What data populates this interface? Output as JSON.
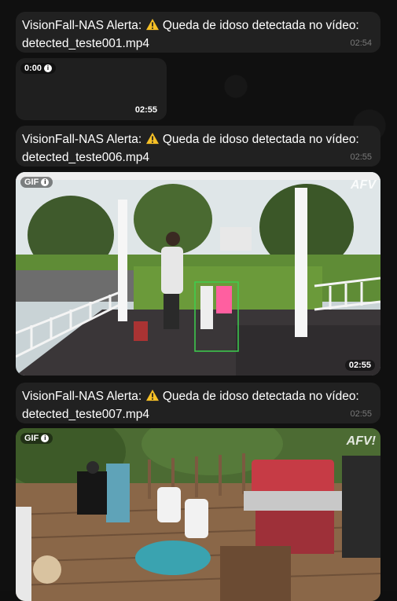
{
  "messages": [
    {
      "sender": "VisionFall-NAS Alerta:",
      "text": "Queda de idoso detectada no vídeo:",
      "file": "detected_teste001.mp4",
      "time": "02:54"
    },
    {
      "sender": "VisionFall-NAS Alerta:",
      "text": "Queda de idoso detectada no vídeo:",
      "file": "detected_teste006.mp4",
      "time": "02:55"
    },
    {
      "sender": "VisionFall-NAS Alerta:",
      "text": "Queda de idoso detectada no vídeo:",
      "file": "detected_teste007.mp4",
      "time": "02:55"
    }
  ],
  "media": [
    {
      "badge": "0:00",
      "time": "02:55"
    },
    {
      "badge": "GIF",
      "time": "02:55",
      "watermark": "AFV"
    },
    {
      "badge": "GIF",
      "watermark": "AFV!"
    }
  ],
  "colors": {
    "bubble": "#212121",
    "background": "#0f0f0f",
    "detection_box": "#3ccf4e"
  }
}
